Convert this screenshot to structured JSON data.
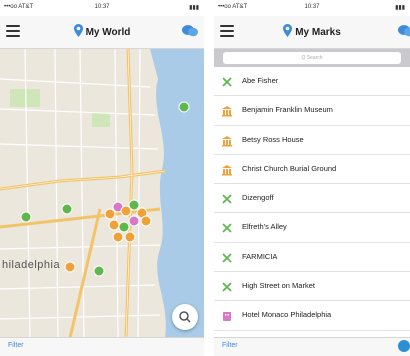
{
  "left_screen": {
    "status": {
      "carrier": "•••oo AT&T",
      "time": "10:37",
      "battery": "▮▮▮"
    },
    "title": "My World",
    "map_label": "hiladelphia",
    "filter_label": "Filter",
    "icons": {
      "menu": "menu-icon",
      "pin": "map-pin-icon",
      "chat": "chat-bubbles-icon",
      "search": "search-icon",
      "locate": "locate-icon"
    }
  },
  "right_screen": {
    "status": {
      "carrier": "•••oo AT&T",
      "time": "10:37",
      "battery": "▮▮▮"
    },
    "title": "My Marks",
    "search_placeholder": "Q Search",
    "filter_label": "Filter",
    "items": [
      {
        "label": "Abe Fisher",
        "icon": "utensils-icon",
        "color": "#5fb84e"
      },
      {
        "label": "Benjamin Franklin Museum",
        "icon": "museum-icon",
        "color": "#f0a23a"
      },
      {
        "label": "Betsy Ross House",
        "icon": "museum-icon",
        "color": "#f0a23a"
      },
      {
        "label": "Christ Church Burial Ground",
        "icon": "museum-icon",
        "color": "#f0a23a"
      },
      {
        "label": "Dizengoff",
        "icon": "utensils-icon",
        "color": "#5fb84e"
      },
      {
        "label": "Elfreth's Alley",
        "icon": "utensils-icon",
        "color": "#5fb84e"
      },
      {
        "label": "FARMICIA",
        "icon": "utensils-icon",
        "color": "#5fb84e"
      },
      {
        "label": "High Street on Market",
        "icon": "utensils-icon",
        "color": "#5fb84e"
      },
      {
        "label": "Hotel Monaco Philadelphia",
        "icon": "hotel-icon",
        "color": "#d978c9"
      }
    ]
  },
  "colors": {
    "accent": "#3d8bd9",
    "river": "#a9cbe8",
    "park": "#bfe0a8"
  }
}
